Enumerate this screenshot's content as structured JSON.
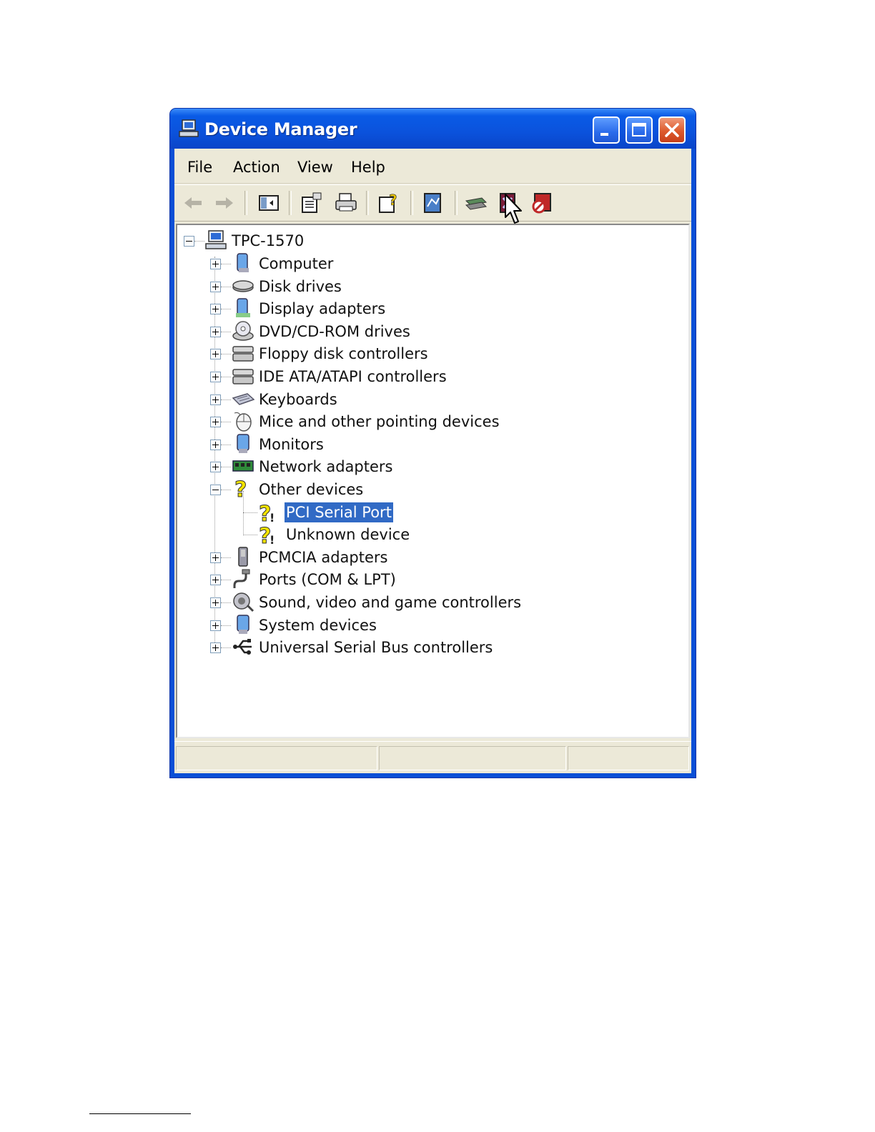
{
  "window": {
    "title": "Device Manager",
    "minimize_icon": "minimize-icon",
    "maximize_icon": "maximize-icon",
    "close_icon": "close-icon"
  },
  "menu": [
    "File",
    "Action",
    "View",
    "Help"
  ],
  "toolbar": [
    "back",
    "forward",
    "show-hide-console-tree",
    "properties",
    "print",
    "help",
    "scan-for-hardware-changes",
    "update-driver",
    "uninstall",
    "disable"
  ],
  "tree": {
    "root": "TPC-1570",
    "categories": [
      "Computer",
      "Disk drives",
      "Display adapters",
      "DVD/CD-ROM drives",
      "Floppy disk controllers",
      "IDE ATA/ATAPI controllers",
      "Keyboards",
      "Mice and other pointing devices",
      "Monitors",
      "Network adapters",
      "Other devices",
      "PCMCIA adapters",
      "Ports (COM & LPT)",
      "Sound, video and game controllers",
      "System devices",
      "Universal Serial Bus controllers"
    ],
    "other_devices_children": [
      "PCI Serial Port",
      "Unknown device"
    ],
    "selected": "PCI Serial Port"
  },
  "colors": {
    "titlebar": "#0b52dc",
    "selection": "#316ac5",
    "warning": "#f3e300"
  }
}
